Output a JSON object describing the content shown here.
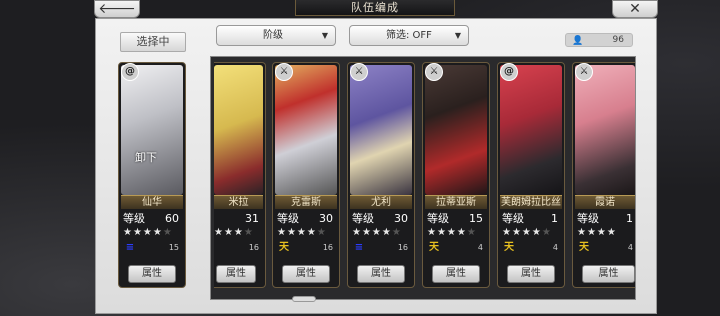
{
  "title": "队伍编成",
  "top_bar": {
    "back_icon": "back-arrow-icon",
    "close_icon": "close-x-icon"
  },
  "selecting_label": "选择中",
  "filters": {
    "sort": {
      "label": "阶级",
      "arrow": "▼"
    },
    "filter": {
      "label": "筛选: OFF",
      "arrow": "▼"
    }
  },
  "unit_count": {
    "icon": "person-icon",
    "value": "96"
  },
  "attr_label": "属性",
  "level_label": "等级",
  "selected_card": {
    "name": "仙华",
    "level": "60",
    "stars_filled": 4,
    "stars_total": 5,
    "sub_value": "15",
    "overlay": "卸下",
    "emblem": "swirl-emblem-icon",
    "weapon_icon": "blue-weapon-icon",
    "colors": {
      "portrait": "#cfcfd4",
      "hair": "#e6e6e6"
    }
  },
  "cards": [
    {
      "name": "米拉",
      "level": "31",
      "stars_filled": 4,
      "sub_value": "16",
      "emblem": "sword-emblem-icon",
      "weapon": "gold",
      "colors": {
        "portrait": "#e9d36a",
        "accent": "#b23a3a"
      }
    },
    {
      "name": "克雷斯",
      "level": "30",
      "stars_filled": 4,
      "sub_value": "16",
      "emblem": "sword-emblem-icon",
      "weapon": "gold",
      "colors": {
        "portrait": "#c59a58",
        "accent": "#d8d8dc"
      }
    },
    {
      "name": "尤利",
      "level": "30",
      "stars_filled": 4,
      "sub_value": "16",
      "emblem": "sword-emblem-icon",
      "weapon": "blue",
      "colors": {
        "portrait": "#7a6fb2",
        "accent": "#e0d4b0"
      }
    },
    {
      "name": "拉蒂亚斯",
      "level": "15",
      "stars_filled": 4,
      "sub_value": "4",
      "emblem": "sword-emblem-icon",
      "weapon": "gold",
      "colors": {
        "portrait": "#3a2e2c",
        "accent": "#b12a2a"
      }
    },
    {
      "name": "芙朗姆拉比丝",
      "level": "1",
      "stars_filled": 4,
      "sub_value": "4",
      "emblem": "swirl-emblem-icon",
      "weapon": "gold",
      "colors": {
        "portrait": "#c23445",
        "accent": "#2c2a2e"
      }
    },
    {
      "name": "霞诺",
      "level": "1",
      "stars_filled": 4,
      "sub_value": "4",
      "emblem": "sword-emblem-icon",
      "weapon": "gold",
      "colors": {
        "portrait": "#e79aa6",
        "accent": "#3a3034"
      }
    }
  ]
}
